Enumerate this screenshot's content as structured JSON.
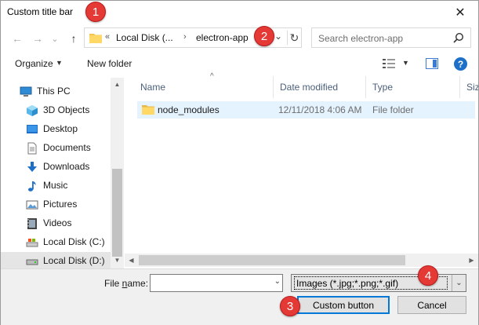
{
  "window": {
    "title": "Custom title bar",
    "close_glyph": "✕"
  },
  "badges": [
    "1",
    "2",
    "3",
    "4"
  ],
  "nav": {
    "back_glyph": "←",
    "forward_glyph": "→",
    "recent_glyph": "⌄",
    "up_glyph": "↑"
  },
  "address": {
    "overflow": "«",
    "segments": [
      "Local Disk (...",
      "electron-app"
    ],
    "separator": "›",
    "dropdown_glyph": "⌄",
    "refresh_glyph": "↻"
  },
  "search": {
    "placeholder": "Search electron-app"
  },
  "toolbar": {
    "organize_label": "Organize",
    "new_folder_label": "New folder",
    "help_glyph": "?"
  },
  "sidebar": {
    "items": [
      {
        "label": "This PC",
        "icon": "computer-icon"
      },
      {
        "label": "3D Objects",
        "icon": "cube-icon"
      },
      {
        "label": "Desktop",
        "icon": "desktop-icon"
      },
      {
        "label": "Documents",
        "icon": "documents-icon"
      },
      {
        "label": "Downloads",
        "icon": "download-arrow-icon"
      },
      {
        "label": "Music",
        "icon": "music-note-icon"
      },
      {
        "label": "Pictures",
        "icon": "pictures-icon"
      },
      {
        "label": "Videos",
        "icon": "video-icon"
      },
      {
        "label": "Local Disk (C:)",
        "icon": "drive-icon"
      },
      {
        "label": "Local Disk (D:)",
        "icon": "drive-icon"
      }
    ]
  },
  "columns": [
    "Name",
    "Date modified",
    "Type",
    "Size"
  ],
  "files": [
    {
      "name": "node_modules",
      "date_modified": "12/11/2018 4:06 AM",
      "type": "File folder"
    }
  ],
  "footer": {
    "file_name_label_pre": "File ",
    "file_name_label_accel": "n",
    "file_name_label_post": "ame:",
    "file_name_value": "",
    "filter_value": "Images (*.jpg;*.png;*.gif)",
    "custom_button_label": "Custom button",
    "cancel_button_label": "Cancel"
  },
  "colors": {
    "badge": "#e53935",
    "selection": "#cce8ff",
    "accent": "#0078d7"
  }
}
